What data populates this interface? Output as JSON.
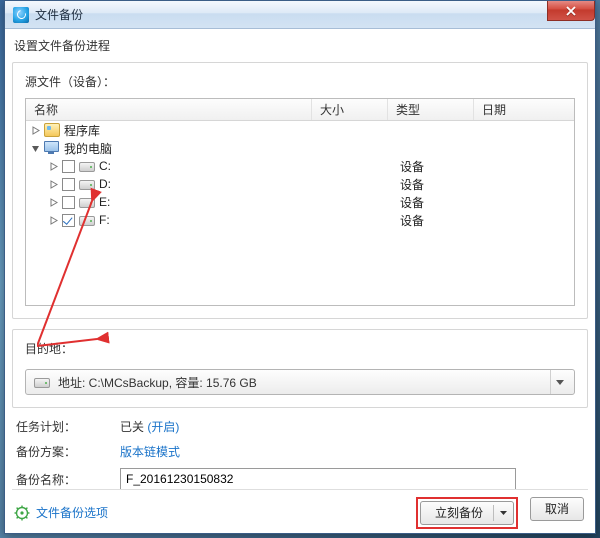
{
  "window": {
    "title": "文件备份"
  },
  "heading": "设置文件备份进程",
  "source": {
    "label": "源文件（设备）：",
    "columns": {
      "name": "名称",
      "size": "大小",
      "type": "类型",
      "date": "日期"
    },
    "nodes": [
      {
        "label": "程序库",
        "icon": "lib",
        "expander": "closed",
        "indent": 0,
        "checkbox": false,
        "type": ""
      },
      {
        "label": "我的电脑",
        "icon": "pc",
        "expander": "open",
        "indent": 0,
        "checkbox": false,
        "type": ""
      },
      {
        "label": "C:",
        "icon": "drive",
        "expander": "closed",
        "indent": 1,
        "checkbox": true,
        "checked": false,
        "type": "设备"
      },
      {
        "label": "D:",
        "icon": "drive",
        "expander": "closed",
        "indent": 1,
        "checkbox": true,
        "checked": false,
        "type": "设备"
      },
      {
        "label": "E:",
        "icon": "drive",
        "expander": "closed",
        "indent": 1,
        "checkbox": true,
        "checked": false,
        "type": "设备"
      },
      {
        "label": "F:",
        "icon": "drive",
        "expander": "closed",
        "indent": 1,
        "checkbox": true,
        "checked": true,
        "type": "设备"
      }
    ]
  },
  "dest": {
    "label": "目的地：",
    "combo_text": "地址: C:\\MCsBackup, 容量: 15.76 GB"
  },
  "plan": {
    "task_label": "任务计划：",
    "task_value": "已关",
    "task_link": "(开启)",
    "scheme_label": "备份方案：",
    "scheme_value": "版本链模式",
    "name_label": "备份名称：",
    "name_value": "F_20161230150832"
  },
  "footer": {
    "options_link": "文件备份选项",
    "backup_now": "立刻备份",
    "cancel": "取消"
  }
}
